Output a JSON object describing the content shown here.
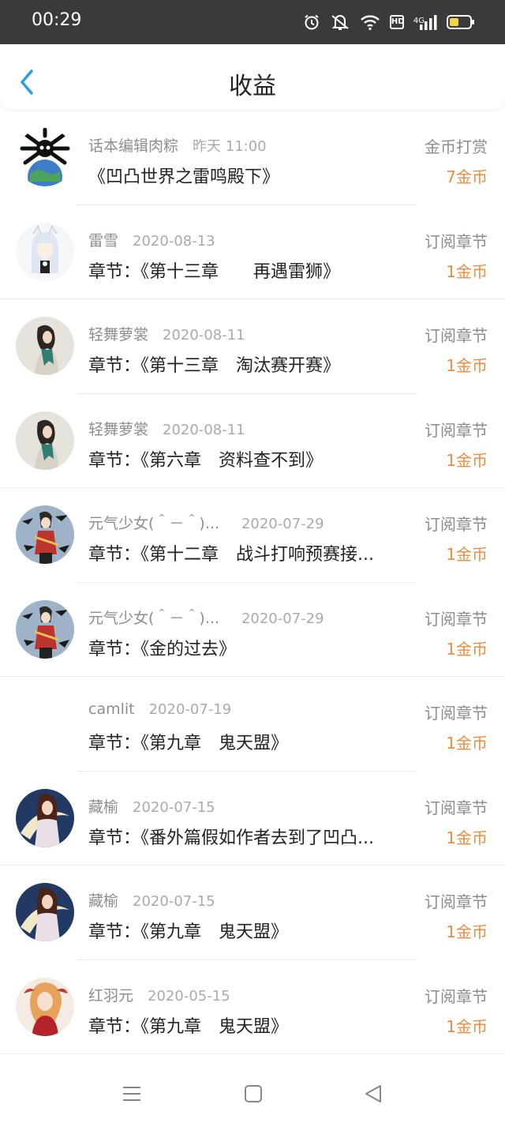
{
  "status_bar": {
    "time": "00:29",
    "network": "4G",
    "hd": "HD"
  },
  "header": {
    "title": "收益"
  },
  "colors": {
    "accent": "#2d9cdb",
    "coin": "#f08a3c",
    "status_bar_bg": "#3a3a3a"
  },
  "items": [
    {
      "name": "话本编辑肉粽",
      "date": "昨天 11:00",
      "chapter": "《凹凸世界之雷鸣殿下》",
      "type": "金币打赏",
      "coins": "7金币",
      "avatar": "skull-globe"
    },
    {
      "name": "雷雪",
      "date": "2020-08-13",
      "chapter": "章节：《第十三章　　再遇雷狮》",
      "type": "订阅章节",
      "coins": "1金币",
      "avatar": "anime-white-hair"
    },
    {
      "name": "轻舞萝裳",
      "date": "2020-08-11",
      "chapter": "章节：《第十三章　淘汰赛开赛》",
      "type": "订阅章节",
      "coins": "1金币",
      "avatar": "girl-scarf"
    },
    {
      "name": "轻舞萝裳",
      "date": "2020-08-11",
      "chapter": "章节：《第六章　资料查不到》",
      "type": "订阅章节",
      "coins": "1金币",
      "avatar": "girl-scarf"
    },
    {
      "name": "元气少女(＾－＾)...",
      "date": "2020-07-29",
      "chapter": "章节：《第十二章　战斗打响预赛接...",
      "type": "订阅章节",
      "coins": "1金币",
      "avatar": "anime-birds"
    },
    {
      "name": "元气少女(＾－＾)...",
      "date": "2020-07-29",
      "chapter": "章节：《金的过去》",
      "type": "订阅章节",
      "coins": "1金币",
      "avatar": "anime-birds"
    },
    {
      "name": "camlit",
      "date": "2020-07-19",
      "chapter": "章节：《第九章　鬼天盟》",
      "type": "订阅章节",
      "coins": "1金币",
      "avatar": "none"
    },
    {
      "name": "藏榆",
      "date": "2020-07-15",
      "chapter": "章节：《番外篇假如作者去到了凹凸...",
      "type": "订阅章节",
      "coins": "1金币",
      "avatar": "anime-moon"
    },
    {
      "name": "藏榆",
      "date": "2020-07-15",
      "chapter": "章节：《第九章　鬼天盟》",
      "type": "订阅章节",
      "coins": "1金币",
      "avatar": "anime-moon"
    },
    {
      "name": "红羽元",
      "date": "2020-05-15",
      "chapter": "章节：《第九章　鬼天盟》",
      "type": "订阅章节",
      "coins": "1金币",
      "avatar": "anime-red"
    }
  ]
}
